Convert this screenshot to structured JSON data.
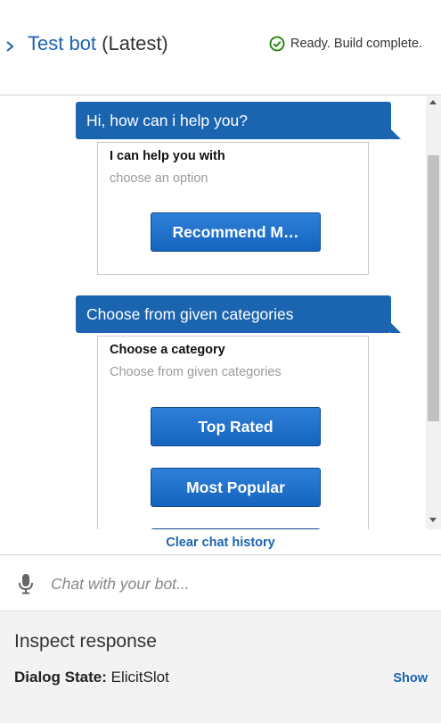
{
  "header": {
    "bot_name": "Test bot",
    "version": "(Latest)",
    "status_text": "Ready. Build complete.",
    "status_icon": "check-circle-icon",
    "status_color": "#1d8102",
    "accent_color": "#1b64b0"
  },
  "chat": {
    "messages": [
      {
        "text": "Hi, how can i help you?",
        "card": {
          "title": "I can help you with",
          "subtitle": "choose an option",
          "buttons": [
            "Recommend M…"
          ]
        }
      },
      {
        "text": "Choose from given categories",
        "card": {
          "title": "Choose a category",
          "subtitle": "Choose from given categories",
          "buttons": [
            "Top Rated",
            "Most Popular"
          ]
        }
      }
    ],
    "clear_history_label": "Clear chat history"
  },
  "input": {
    "placeholder": "Chat with your bot...",
    "mic_icon": "microphone-icon"
  },
  "inspect": {
    "title": "Inspect response",
    "dialog_state_label": "Dialog State:",
    "dialog_state_value": "ElicitSlot",
    "show_label": "Show"
  }
}
